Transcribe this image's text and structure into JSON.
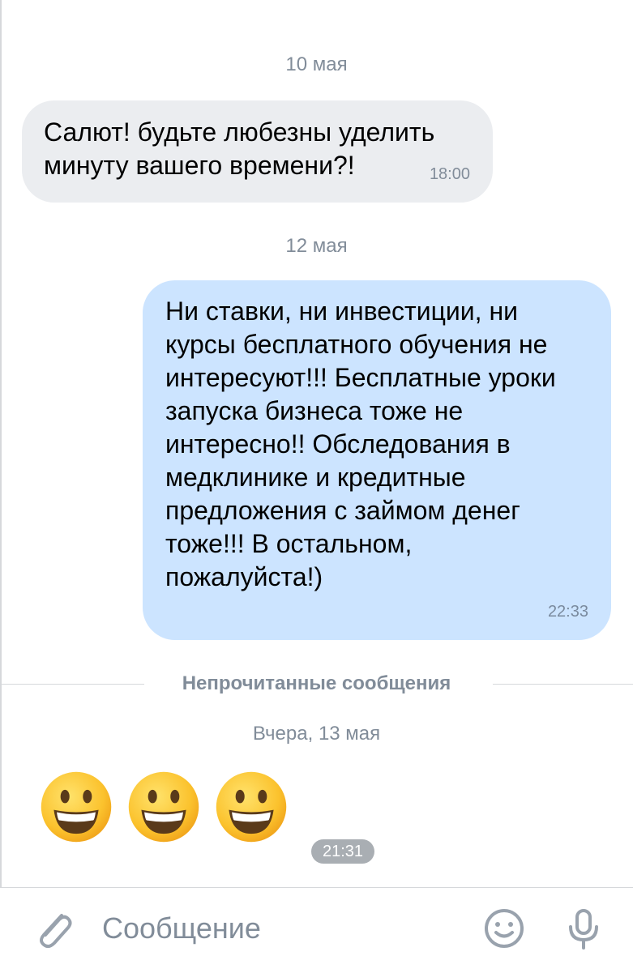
{
  "chat": {
    "date_1": "10 мая",
    "message_1": {
      "text": "Салют! будьте любезны уделить\nминуту вашего времени?!",
      "time": "18:00"
    },
    "date_2": "12 мая",
    "message_2": {
      "text": "Ни ставки, ни инвестиции, ни\nкурсы бесплатного обучения не\nинтересуют!!! Бесплатные уроки\nзапуска бизнеса тоже не\nинтересно!! Обследования в\nмедклинике и кредитные\nпредложения с займом денег\nтоже!!! В остальном,\nпожалуйста!)",
      "time": "22:33"
    },
    "unread_divider": "Непрочитанные сообщения",
    "date_3": "Вчера, 13 мая",
    "message_3": {
      "emojis": [
        "grinning-face",
        "grinning-face",
        "grinning-face"
      ],
      "time": "21:31"
    }
  },
  "composer": {
    "placeholder": "Сообщение",
    "icons": [
      "paperclip-icon",
      "smile-icon",
      "microphone-icon"
    ]
  },
  "colors": {
    "incoming_bubble": "#ebedf0",
    "outgoing_bubble": "#cce4ff",
    "secondary_text": "#818c99",
    "icon": "#99a2ad"
  }
}
